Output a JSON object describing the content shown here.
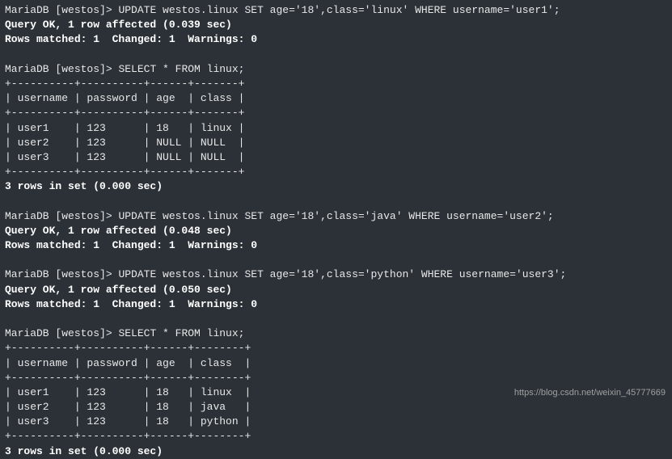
{
  "prompt": "MariaDB [westos]> ",
  "cmd1": "UPDATE westos.linux SET age='18',class='linux' WHERE username='user1';",
  "result1_l1": "Query OK, 1 row affected (0.039 sec)",
  "result1_l2": "Rows matched: 1  Changed: 1  Warnings: 0",
  "cmd2": "SELECT * FROM linux;",
  "table1": {
    "sep": "+----------+----------+------+-------+",
    "header": "| username | password | age  | class |",
    "rows": [
      "| user1    | 123      | 18   | linux |",
      "| user2    | 123      | NULL | NULL  |",
      "| user3    | 123      | NULL | NULL  |"
    ]
  },
  "result2": "3 rows in set (0.000 sec)",
  "cmd3": "UPDATE westos.linux SET age='18',class='java' WHERE username='user2';",
  "result3_l1": "Query OK, 1 row affected (0.048 sec)",
  "result3_l2": "Rows matched: 1  Changed: 1  Warnings: 0",
  "cmd4": "UPDATE westos.linux SET age='18',class='python' WHERE username='user3';",
  "result4_l1": "Query OK, 1 row affected (0.050 sec)",
  "result4_l2": "Rows matched: 1  Changed: 1  Warnings: 0",
  "cmd5": "SELECT * FROM linux;",
  "table2": {
    "sep": "+----------+----------+------+--------+",
    "header": "| username | password | age  | class  |",
    "rows": [
      "| user1    | 123      | 18   | linux  |",
      "| user2    | 123      | 18   | java   |",
      "| user3    | 123      | 18   | python |"
    ]
  },
  "result5": "3 rows in set (0.000 sec)",
  "watermark": "https://blog.csdn.net/weixin_45777669"
}
